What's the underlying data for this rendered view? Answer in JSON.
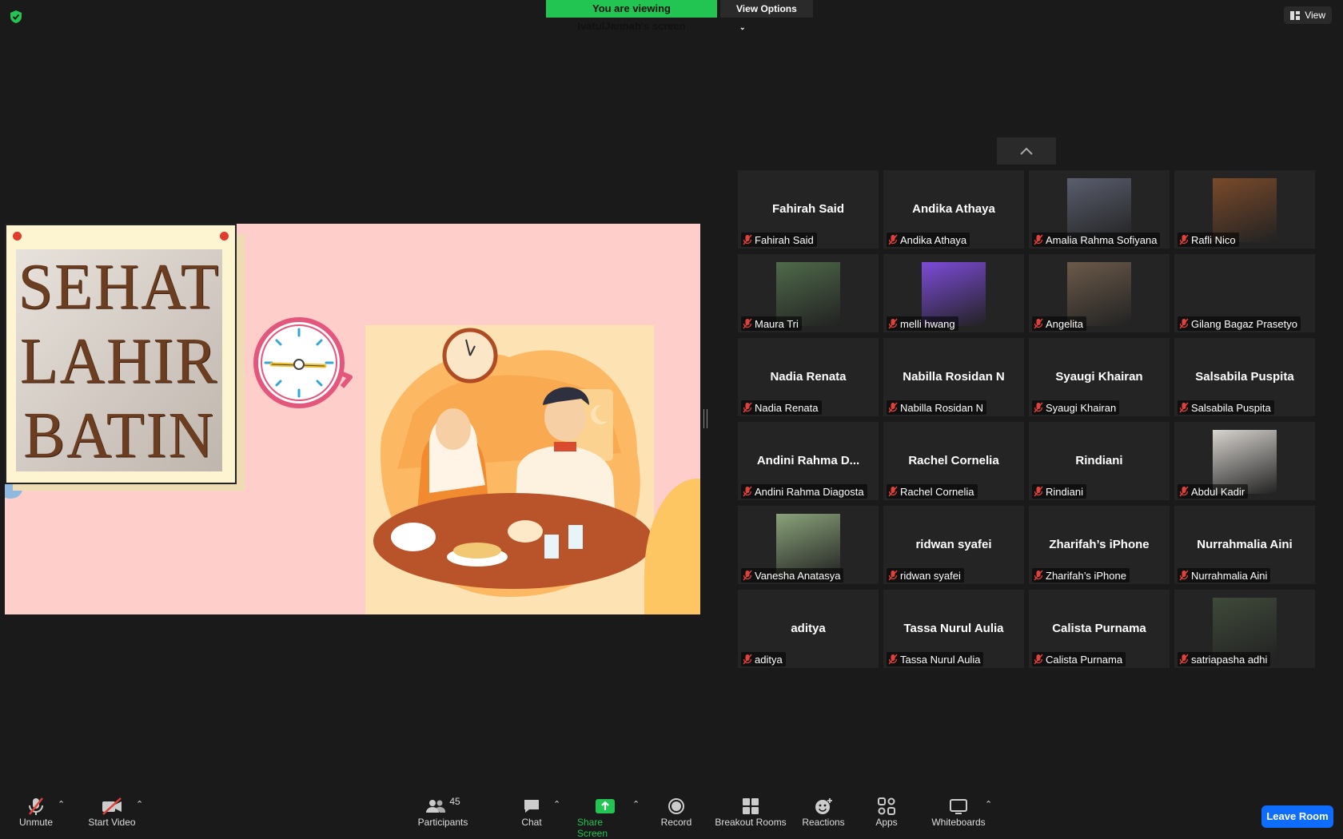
{
  "top_banner": {
    "viewing": "You are viewing IvatulJannah's screen",
    "view_options": "View Options"
  },
  "view_button": "View",
  "shared_slide": {
    "words": [
      "SEHAT",
      "LAHIR",
      "BATIN"
    ]
  },
  "gallery": [
    {
      "display": "Fahirah Said",
      "label": "Fahirah Said",
      "photo": false
    },
    {
      "display": "Andika Athaya",
      "label": "Andika Athaya",
      "photo": false
    },
    {
      "display": "",
      "label": "Amalia Rahma Sofiyana",
      "photo": true,
      "tone": "#5a5e6e"
    },
    {
      "display": "",
      "label": "Rafli Nico",
      "photo": true,
      "tone": "#7a4a2a"
    },
    {
      "display": "",
      "label": "Maura Tri",
      "photo": true,
      "tone": "#4f6a4a"
    },
    {
      "display": "",
      "label": "melli hwang",
      "photo": true,
      "tone": "#7d4bd9"
    },
    {
      "display": "",
      "label": "Angelita",
      "photo": true,
      "tone": "#6b5a4a"
    },
    {
      "display": "",
      "label": "Gilang Bagaz Prasetyo",
      "photo": false
    },
    {
      "display": "Nadia Renata",
      "label": "Nadia Renata",
      "photo": false
    },
    {
      "display": "Nabilla Rosidan N",
      "label": "Nabilla Rosidan N",
      "photo": false
    },
    {
      "display": "Syaugi Khairan",
      "label": "Syaugi Khairan",
      "photo": false
    },
    {
      "display": "Salsabila Puspita",
      "label": "Salsabila Puspita",
      "photo": false
    },
    {
      "display": "Andini Rahma D...",
      "label": "Andini Rahma Diagosta",
      "photo": false
    },
    {
      "display": "Rachel Cornelia",
      "label": "Rachel Cornelia",
      "photo": false
    },
    {
      "display": "Rindiani",
      "label": "Rindiani",
      "photo": false
    },
    {
      "display": "",
      "label": "Abdul Kadir",
      "photo": true,
      "tone": "#d8d4cf"
    },
    {
      "display": "",
      "label": "Vanesha Anatasya",
      "photo": true,
      "tone": "#8aa37a"
    },
    {
      "display": "ridwan syafei",
      "label": "ridwan syafei",
      "photo": false
    },
    {
      "display": "Zharifah’s iPhone",
      "label": "Zharifah’s iPhone",
      "photo": false
    },
    {
      "display": "Nurrahmalia Aini",
      "label": "Nurrahmalia Aini",
      "photo": false
    },
    {
      "display": "aditya",
      "label": "aditya",
      "photo": false
    },
    {
      "display": "Tassa Nurul Aulia",
      "label": "Tassa Nurul Aulia",
      "photo": false
    },
    {
      "display": "Calista Purnama",
      "label": "Calista Purnama",
      "photo": false
    },
    {
      "display": "",
      "label": "satriapasha adhi",
      "photo": true,
      "tone": "#3f4a3a"
    }
  ],
  "toolbar": {
    "unmute": "Unmute",
    "start_video": "Start Video",
    "participants": "Participants",
    "participants_count": "45",
    "chat": "Chat",
    "share_screen": "Share Screen",
    "record": "Record",
    "breakout": "Breakout Rooms",
    "reactions": "Reactions",
    "apps": "Apps",
    "whiteboards": "Whiteboards",
    "leave": "Leave Room"
  },
  "colors": {
    "share_green": "#23c552",
    "leave_blue": "#0e6cff",
    "muted_red": "#e0413a"
  }
}
